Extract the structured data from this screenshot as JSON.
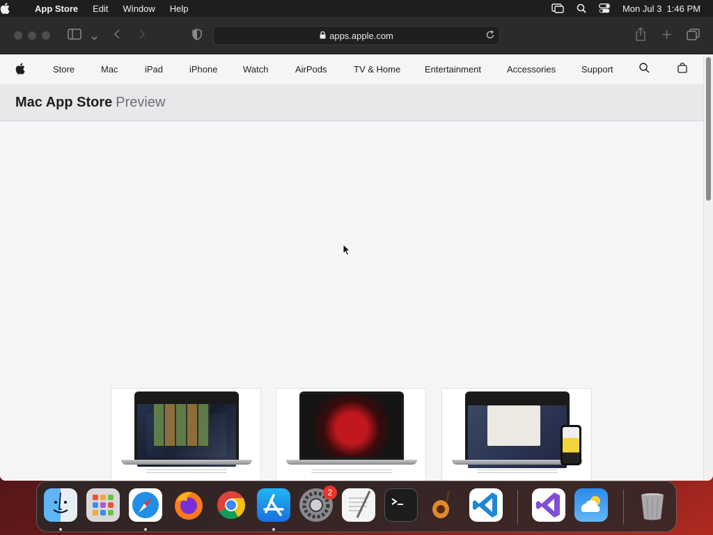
{
  "menubar": {
    "app_name": "App Store",
    "items": [
      "Edit",
      "Window",
      "Help"
    ],
    "date": "Mon Jul 3",
    "time": "1:46 PM"
  },
  "browser": {
    "url": "apps.apple.com"
  },
  "globalnav": {
    "links": [
      "Store",
      "Mac",
      "iPad",
      "iPhone",
      "Watch",
      "AirPods",
      "TV & Home",
      "Entertainment",
      "Accessories",
      "Support"
    ]
  },
  "localnav": {
    "title": "Mac App Store",
    "subtitle": "Preview"
  },
  "dock": {
    "apps": [
      "Finder",
      "Launchpad",
      "Safari",
      "Firefox",
      "Chrome",
      "App Store",
      "System Settings",
      "TextEdit",
      "Terminal",
      "GarageBand",
      "Visual Studio Code",
      "Visual Studio",
      "Weather",
      "Trash"
    ],
    "settings_badge": "2"
  }
}
